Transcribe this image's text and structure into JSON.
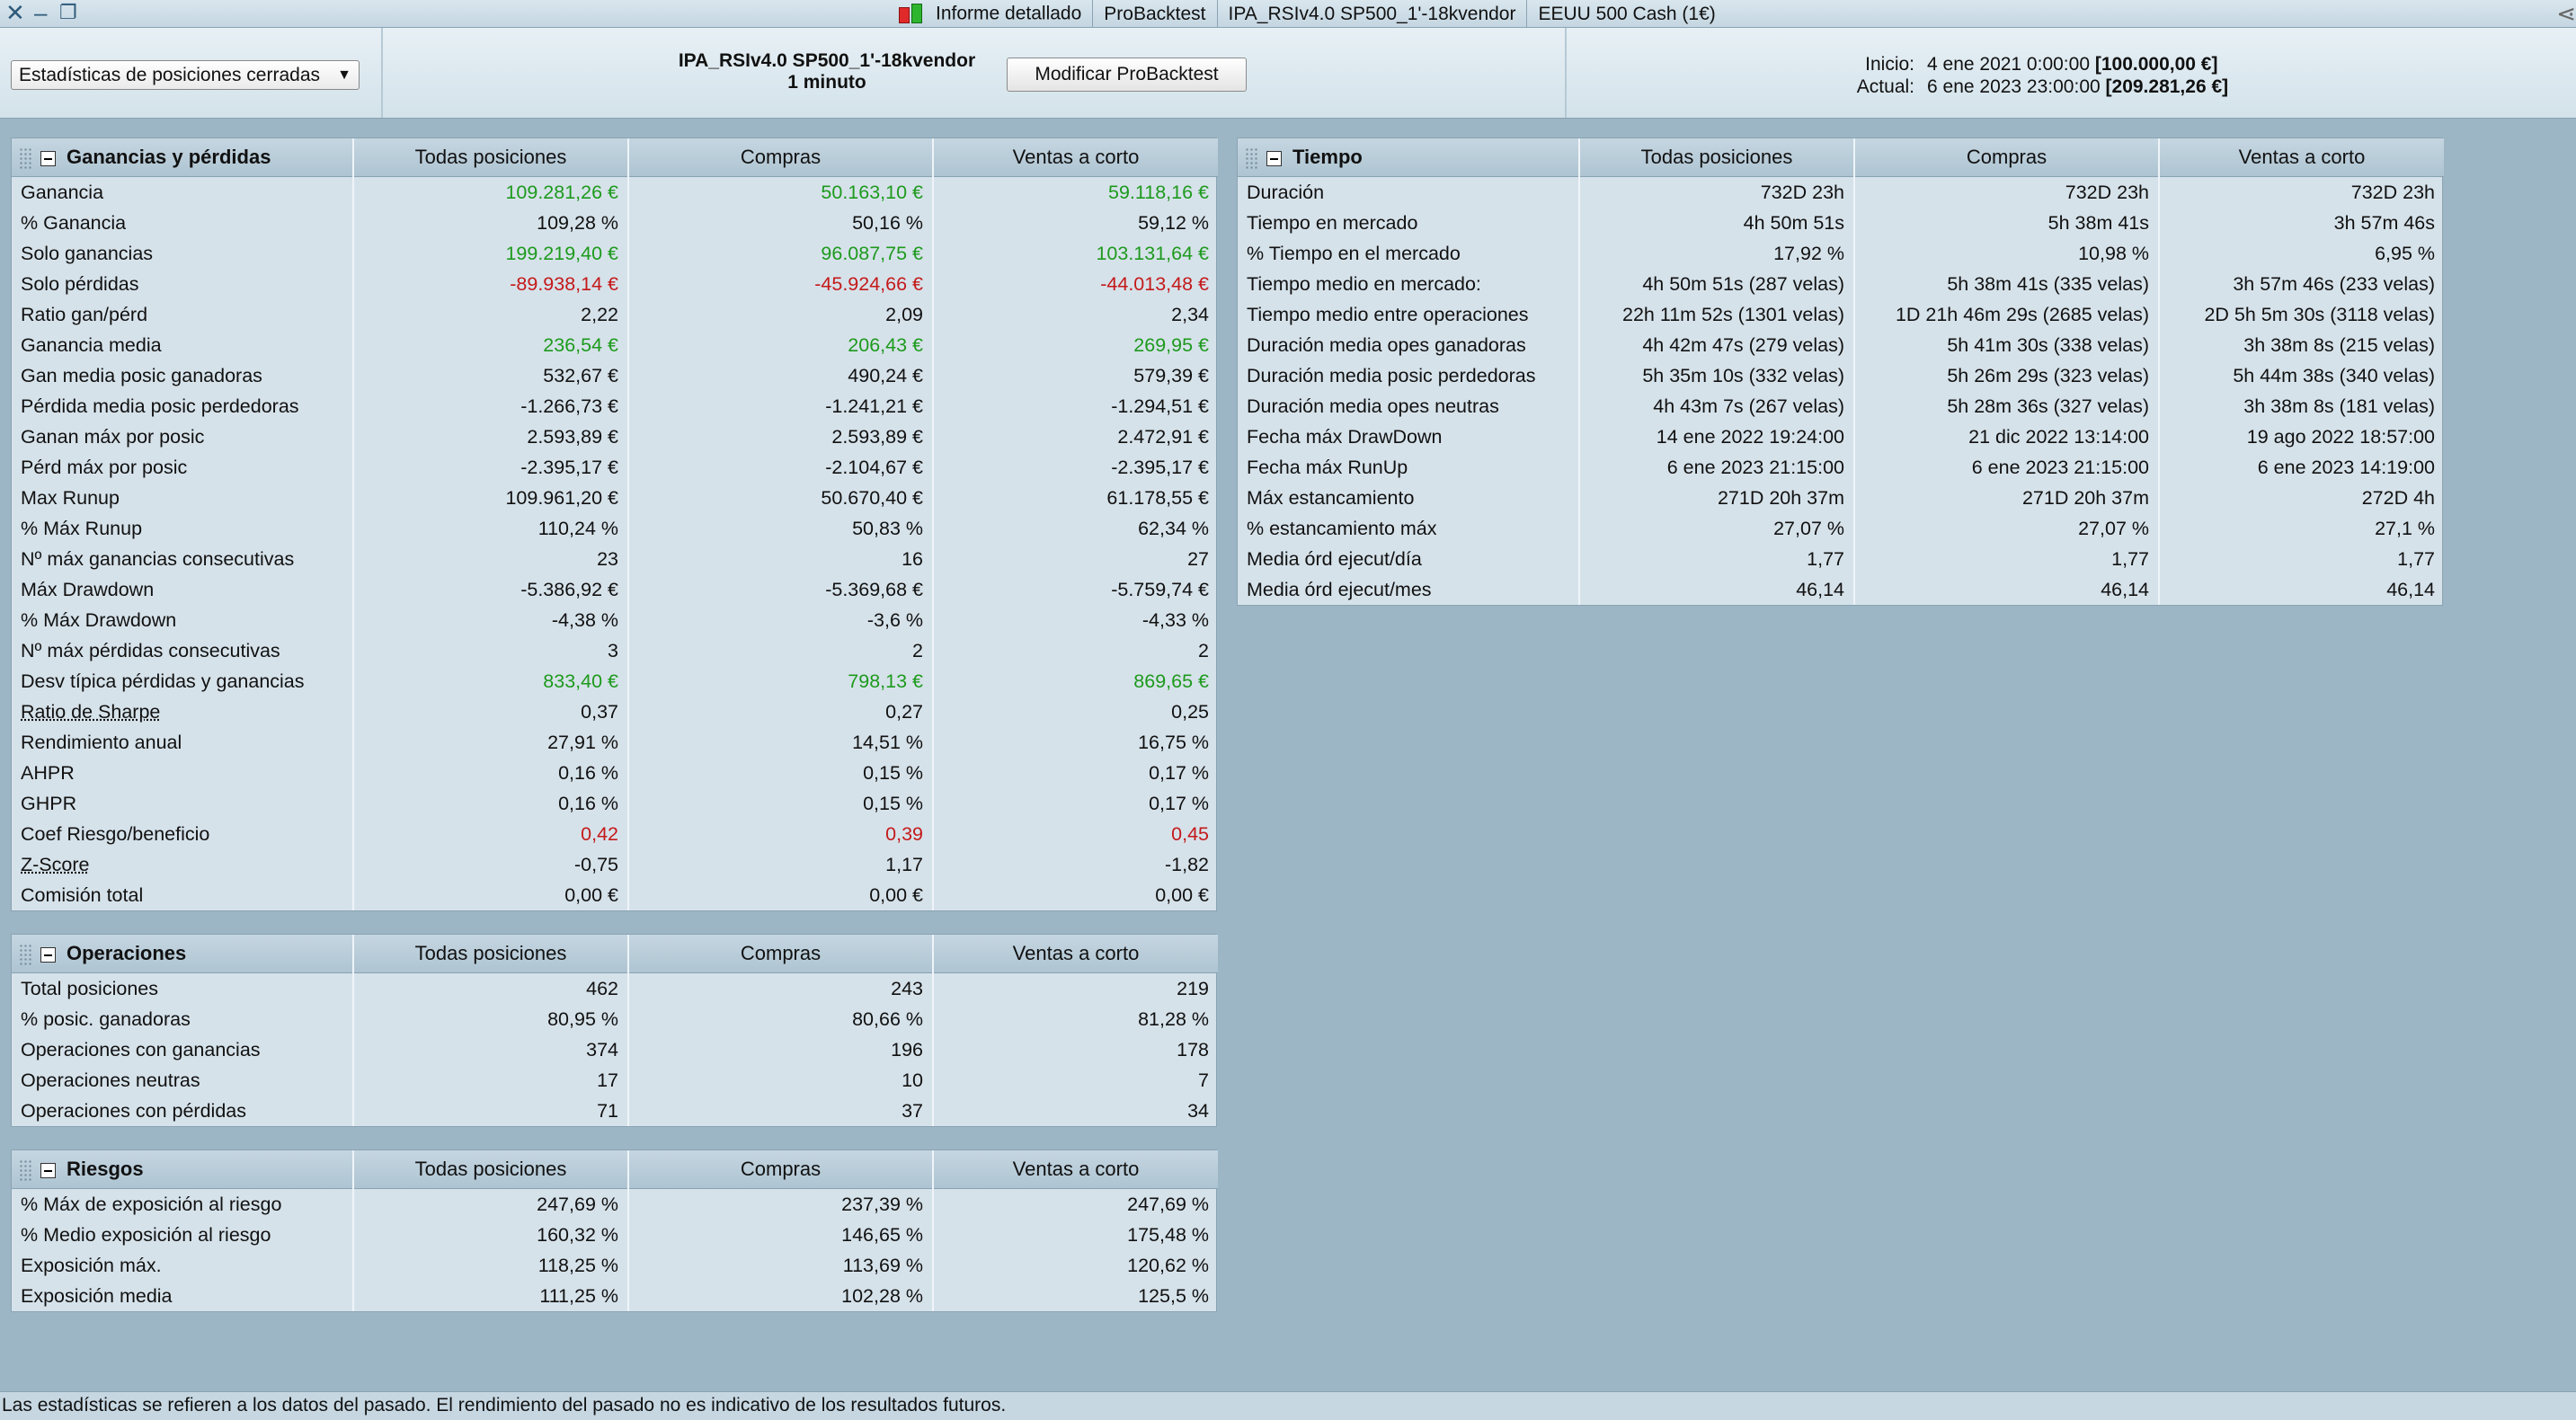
{
  "titlebar": {
    "tabs": [
      "Informe detallado",
      "ProBacktest",
      "IPA_RSIv4.0 SP500_1'-18kvendor",
      "EEUU 500 Cash (1€)"
    ]
  },
  "header": {
    "dropdown_value": "Estadísticas de posiciones cerradas",
    "strategy_name": "IPA_RSIv4.0 SP500_1'-18kvendor",
    "timeframe": "1 minuto",
    "modify_button": "Modificar ProBacktest",
    "start_label": "Inicio:",
    "start_date": "4 ene 2021 0:00:00",
    "start_value": "[100.000,00 €]",
    "current_label": "Actual:",
    "current_date": "6 ene 2023 23:00:00",
    "current_value": "[209.281,26 €]"
  },
  "colors": {
    "positive": "#1d9a1d",
    "negative": "#c41a1a",
    "background": "#9db6c5"
  },
  "column_headers": [
    "Todas posiciones",
    "Compras",
    "Ventas a corto"
  ],
  "panels": {
    "ganancias": {
      "title": "Ganancias y pérdidas",
      "rows": [
        {
          "label": "Ganancia",
          "values": [
            "109.281,26 €",
            "50.163,10 €",
            "59.118,16 €"
          ],
          "color": "green"
        },
        {
          "label": "% Ganancia",
          "values": [
            "109,28 %",
            "50,16 %",
            "59,12 %"
          ]
        },
        {
          "label": "Solo ganancias",
          "values": [
            "199.219,40 €",
            "96.087,75 €",
            "103.131,64 €"
          ],
          "color": "green"
        },
        {
          "label": "Solo pérdidas",
          "values": [
            "-89.938,14 €",
            "-45.924,66 €",
            "-44.013,48 €"
          ],
          "color": "red"
        },
        {
          "label": "Ratio gan/pérd",
          "values": [
            "2,22",
            "2,09",
            "2,34"
          ]
        },
        {
          "label": "Ganancia media",
          "values": [
            "236,54 €",
            "206,43 €",
            "269,95 €"
          ],
          "color": "green"
        },
        {
          "label": "Gan media posic ganadoras",
          "values": [
            "532,67 €",
            "490,24 €",
            "579,39 €"
          ]
        },
        {
          "label": "Pérdida media posic perdedoras",
          "values": [
            "-1.266,73 €",
            "-1.241,21 €",
            "-1.294,51 €"
          ]
        },
        {
          "label": "Ganan máx por posic",
          "values": [
            "2.593,89 €",
            "2.593,89 €",
            "2.472,91 €"
          ]
        },
        {
          "label": "Pérd máx por posic",
          "values": [
            "-2.395,17 €",
            "-2.104,67 €",
            "-2.395,17 €"
          ]
        },
        {
          "label": "Max Runup",
          "values": [
            "109.961,20 €",
            "50.670,40 €",
            "61.178,55 €"
          ]
        },
        {
          "label": "% Máx Runup",
          "values": [
            "110,24 %",
            "50,83 %",
            "62,34 %"
          ]
        },
        {
          "label": "Nº máx ganancias consecutivas",
          "values": [
            "23",
            "16",
            "27"
          ]
        },
        {
          "label": "Máx Drawdown",
          "values": [
            "-5.386,92 €",
            "-5.369,68 €",
            "-5.759,74 €"
          ]
        },
        {
          "label": "% Máx Drawdown",
          "values": [
            "-4,38 %",
            "-3,6 %",
            "-4,33 %"
          ]
        },
        {
          "label": "Nº máx pérdidas consecutivas",
          "values": [
            "3",
            "2",
            "2"
          ]
        },
        {
          "label": "Desv típica pérdidas y ganancias",
          "values": [
            "833,40 €",
            "798,13 €",
            "869,65 €"
          ],
          "color": "green"
        },
        {
          "label": "Ratio de Sharpe",
          "values": [
            "0,37",
            "0,27",
            "0,25"
          ],
          "underline": true
        },
        {
          "label": "Rendimiento anual",
          "values": [
            "27,91 %",
            "14,51 %",
            "16,75 %"
          ]
        },
        {
          "label": "AHPR",
          "values": [
            "0,16 %",
            "0,15 %",
            "0,17 %"
          ]
        },
        {
          "label": "GHPR",
          "values": [
            "0,16 %",
            "0,15 %",
            "0,17 %"
          ]
        },
        {
          "label": "Coef Riesgo/beneficio",
          "values": [
            "0,42",
            "0,39",
            "0,45"
          ],
          "color": "red"
        },
        {
          "label": "Z-Score",
          "values": [
            "-0,75",
            "1,17",
            "-1,82"
          ],
          "underline": true
        },
        {
          "label": "Comisión total",
          "values": [
            "0,00 €",
            "0,00 €",
            "0,00 €"
          ]
        }
      ]
    },
    "operaciones": {
      "title": "Operaciones",
      "rows": [
        {
          "label": "Total posiciones",
          "values": [
            "462",
            "243",
            "219"
          ]
        },
        {
          "label": "% posic. ganadoras",
          "values": [
            "80,95 %",
            "80,66 %",
            "81,28 %"
          ]
        },
        {
          "label": "Operaciones con ganancias",
          "values": [
            "374",
            "196",
            "178"
          ]
        },
        {
          "label": "Operaciones neutras",
          "values": [
            "17",
            "10",
            "7"
          ]
        },
        {
          "label": "Operaciones con pérdidas",
          "values": [
            "71",
            "37",
            "34"
          ]
        }
      ]
    },
    "riesgos": {
      "title": "Riesgos",
      "rows": [
        {
          "label": "% Máx de exposición al riesgo",
          "values": [
            "247,69 %",
            "237,39 %",
            "247,69 %"
          ]
        },
        {
          "label": "% Medio exposición al riesgo",
          "values": [
            "160,32 %",
            "146,65 %",
            "175,48 %"
          ]
        },
        {
          "label": "Exposición máx.",
          "values": [
            "118,25 %",
            "113,69 %",
            "120,62 %"
          ]
        },
        {
          "label": "Exposición media",
          "values": [
            "111,25 %",
            "102,28 %",
            "125,5 %"
          ]
        }
      ]
    },
    "tiempo": {
      "title": "Tiempo",
      "rows": [
        {
          "label": "Duración",
          "values": [
            "732D 23h",
            "732D 23h",
            "732D 23h"
          ]
        },
        {
          "label": "Tiempo en mercado",
          "values": [
            "4h 50m 51s",
            "5h 38m 41s",
            "3h 57m 46s"
          ]
        },
        {
          "label": "% Tiempo en el mercado",
          "values": [
            "17,92 %",
            "10,98 %",
            "6,95 %"
          ]
        },
        {
          "label": "Tiempo medio en mercado:",
          "values": [
            "4h 50m 51s (287 velas)",
            "5h 38m 41s (335 velas)",
            "3h 57m 46s (233 velas)"
          ]
        },
        {
          "label": "Tiempo medio entre operaciones",
          "values": [
            "22h 11m 52s (1301 velas)",
            "1D 21h 46m 29s (2685 velas)",
            "2D 5h 5m 30s (3118 velas)"
          ]
        },
        {
          "label": "Duración media opes ganadoras",
          "values": [
            "4h 42m 47s (279 velas)",
            "5h 41m 30s (338 velas)",
            "3h 38m 8s (215 velas)"
          ]
        },
        {
          "label": "Duración media posic perdedoras",
          "values": [
            "5h 35m 10s (332 velas)",
            "5h 26m 29s (323 velas)",
            "5h 44m 38s (340 velas)"
          ]
        },
        {
          "label": "Duración media opes neutras",
          "values": [
            "4h 43m 7s (267 velas)",
            "5h 28m 36s (327 velas)",
            "3h 38m 8s (181 velas)"
          ]
        },
        {
          "label": "Fecha máx DrawDown",
          "values": [
            "14 ene 2022 19:24:00",
            "21 dic 2022 13:14:00",
            "19 ago 2022 18:57:00"
          ]
        },
        {
          "label": "Fecha máx RunUp",
          "values": [
            "6 ene 2023 21:15:00",
            "6 ene 2023 21:15:00",
            "6 ene 2023 14:19:00"
          ]
        },
        {
          "label": "Máx estancamiento",
          "values": [
            "271D 20h 37m",
            "271D 20h 37m",
            "272D 4h"
          ]
        },
        {
          "label": "% estancamiento máx",
          "values": [
            "27,07 %",
            "27,07 %",
            "27,1 %"
          ]
        },
        {
          "label": "Media órd ejecut/día",
          "values": [
            "1,77",
            "1,77",
            "1,77"
          ]
        },
        {
          "label": "Media órd ejecut/mes",
          "values": [
            "46,14",
            "46,14",
            "46,14"
          ]
        }
      ]
    }
  },
  "footer": {
    "disclaimer": "Las estadísticas se refieren a los datos del pasado. El rendimiento del pasado no es indicativo de los resultados futuros."
  }
}
